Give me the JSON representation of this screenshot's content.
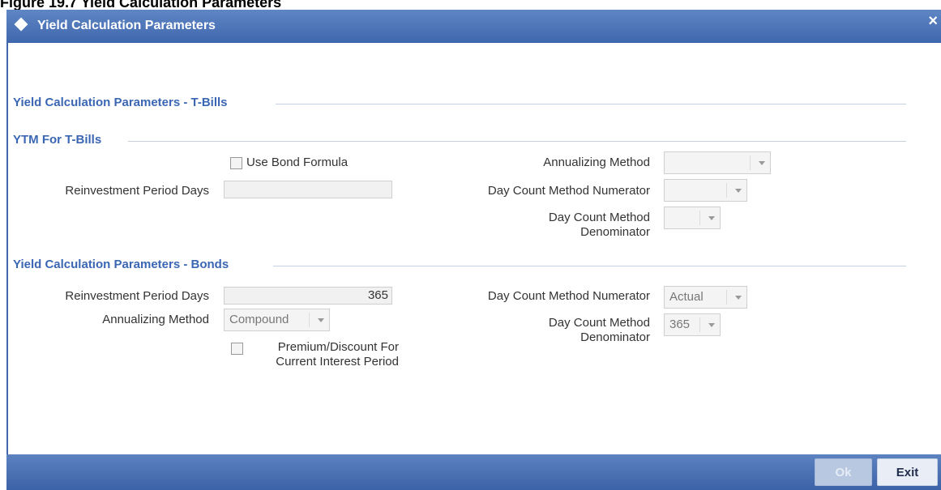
{
  "caption": "Figure 19.7 Yield Calculation Parameters",
  "window": {
    "title": "Yield Calculation Parameters",
    "close_symbol": "×"
  },
  "sections": {
    "tbills": "Yield Calculation Parameters - T-Bills",
    "ytm": "YTM For T-Bills",
    "bonds": "Yield Calculation Parameters - Bonds"
  },
  "ytm": {
    "use_bond_formula_label": "Use Bond Formula",
    "use_bond_formula_checked": false,
    "reinvestment_period_days_label": "Reinvestment Period Days",
    "reinvestment_period_days_value": "",
    "annualizing_method_label": "Annualizing Method",
    "annualizing_method_value": "",
    "day_count_numerator_label": "Day Count Method Numerator",
    "day_count_numerator_value": "",
    "day_count_denominator_label": "Day Count Method Denominator",
    "day_count_denominator_value": ""
  },
  "bonds": {
    "reinvestment_period_days_label": "Reinvestment Period Days",
    "reinvestment_period_days_value": "365",
    "annualizing_method_label": "Annualizing Method",
    "annualizing_method_value": "Compound",
    "premium_discount_label": "Premium/Discount For Current Interest Period",
    "premium_discount_checked": false,
    "day_count_numerator_label": "Day Count Method Numerator",
    "day_count_numerator_value": "Actual",
    "day_count_denominator_label": "Day Count Method Denominator",
    "day_count_denominator_value": "365"
  },
  "footer": {
    "ok_label": "Ok",
    "exit_label": "Exit"
  },
  "colors": {
    "title_bar": "#4a72b8",
    "section_title": "#3a66b3"
  }
}
